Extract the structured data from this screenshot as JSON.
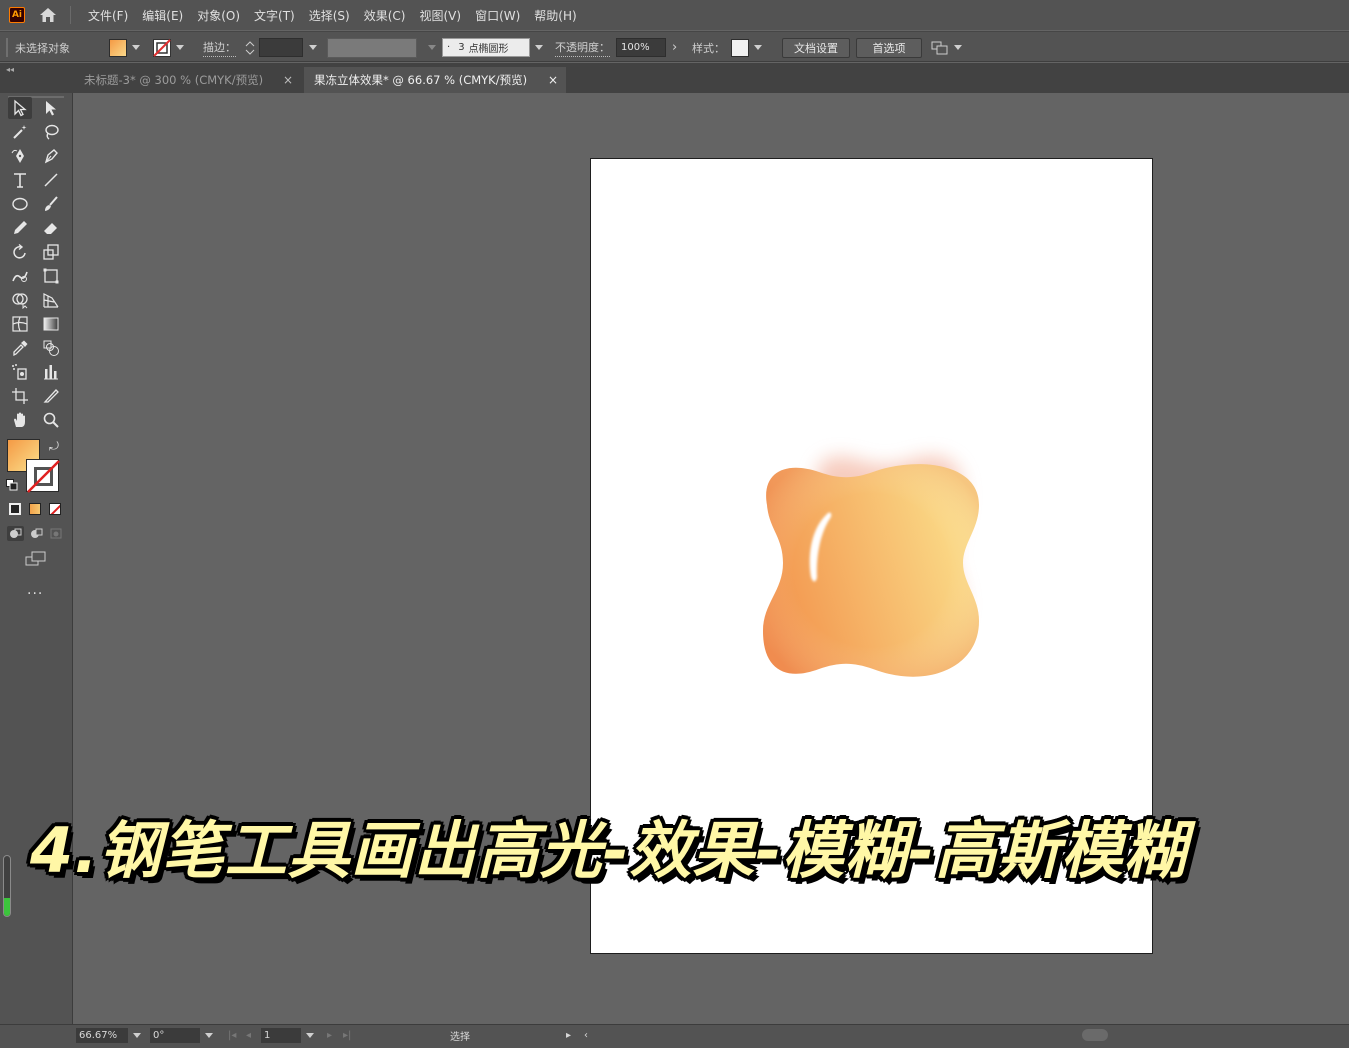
{
  "app": {
    "logo_text": "Ai"
  },
  "menubar": {
    "items": [
      "文件(F)",
      "编辑(E)",
      "对象(O)",
      "文字(T)",
      "选择(S)",
      "效果(C)",
      "视图(V)",
      "窗口(W)",
      "帮助(H)"
    ]
  },
  "control_bar": {
    "selection_status": "未选择对象",
    "fill_color": "#f7a14a",
    "stroke_label": "描边",
    "brush_size": "3",
    "brush_name": "点椭圆形",
    "opacity_label": "不透明度",
    "opacity_value": "100%",
    "style_label": "样式",
    "document_setup_button": "文档设置",
    "preferences_button": "首选项"
  },
  "tabs": [
    {
      "label": "未标题-3* @ 300 % (CMYK/预览)",
      "active": false
    },
    {
      "label": "果冻立体效果* @ 66.67 % (CMYK/预览)",
      "active": true
    }
  ],
  "tools": {
    "fill_color": "#f49a45",
    "active_tool": "curvature-tool",
    "more_tools": "..."
  },
  "caption": {
    "text": "4.钢笔工具画出高光-效果-模糊-高斯模糊"
  },
  "status_bar": {
    "zoom": "66.67%",
    "rotation": "0°",
    "artboard_number": "1",
    "tool_status": "选择"
  },
  "artwork": {
    "gradient_start": "#f2924b",
    "gradient_end": "#fbe08c",
    "shadow_color": "#f0a38a"
  },
  "side_slider": {
    "level": 0.3
  }
}
